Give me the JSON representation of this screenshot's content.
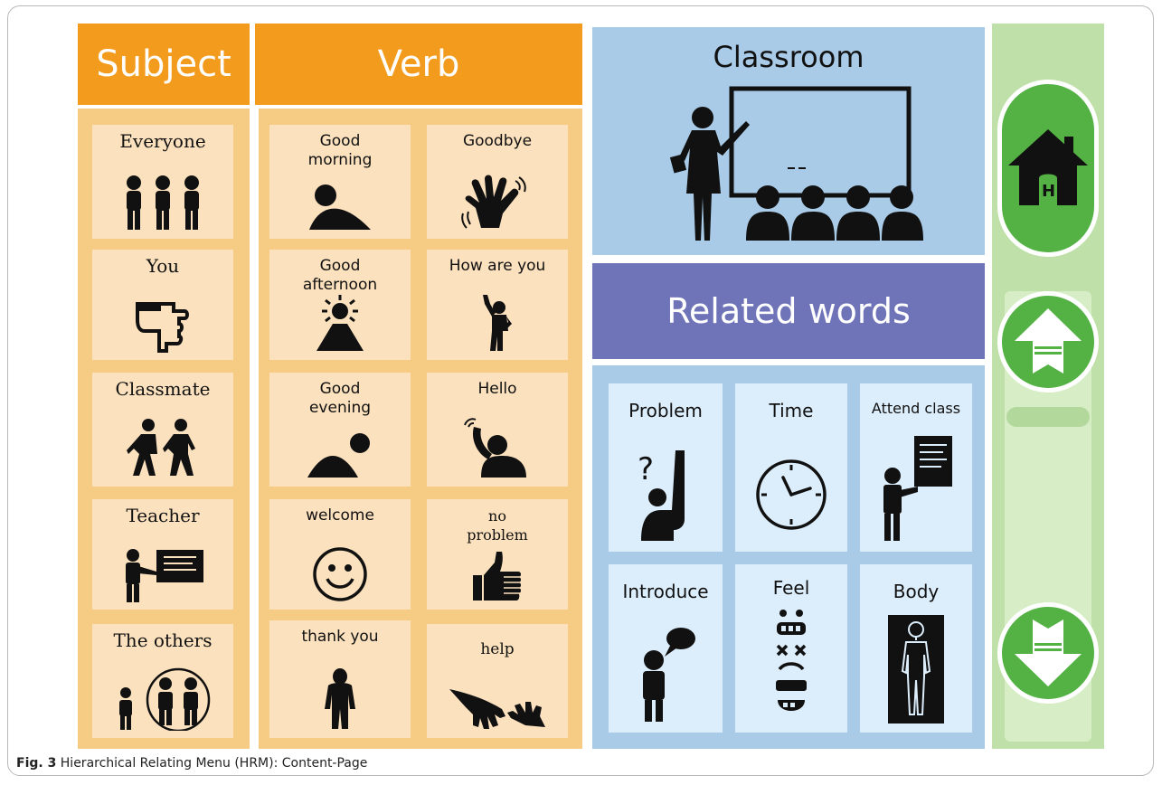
{
  "headers": {
    "subject": "Subject",
    "verb": "Verb"
  },
  "subject_items": [
    "Everyone",
    "You",
    "Classmate",
    "Teacher",
    "The others"
  ],
  "verb_items": [
    [
      "Good\nmorning",
      "Goodbye"
    ],
    [
      "Good\nafternoon",
      "How are you"
    ],
    [
      "Good\nevening",
      "Hello"
    ],
    [
      "welcome",
      "no\nproblem"
    ],
    [
      "thank you",
      "help"
    ]
  ],
  "classroom": {
    "title": "Classroom"
  },
  "related": {
    "title": "Related words",
    "items": [
      "Problem",
      "Time",
      "Attend class",
      "Introduce",
      "Feel",
      "Body"
    ]
  },
  "nav": {
    "home_icon": "home-icon",
    "up_icon": "up-arrow-icon",
    "down_icon": "down-arrow-icon"
  },
  "caption": {
    "fig": "Fig. 3",
    "text": "Hierarchical Relating Menu (HRM): Content-Page"
  },
  "colors": {
    "orange": "#f39b1d",
    "sand": "#f6cb84",
    "card": "#fbe1bd",
    "blue": "#a9cbe8",
    "purple": "#6f73b8",
    "green": "#54b245"
  }
}
